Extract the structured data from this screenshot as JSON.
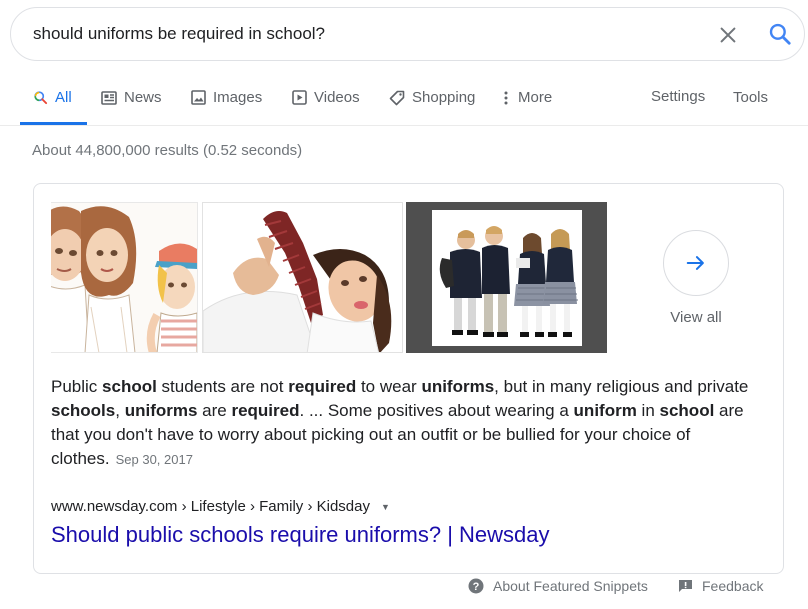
{
  "search": {
    "query": "should uniforms be required in school?"
  },
  "tabs": [
    {
      "label": "All",
      "icon": "search-icon",
      "active": true
    },
    {
      "label": "News",
      "icon": "news-icon"
    },
    {
      "label": "Images",
      "icon": "image-icon"
    },
    {
      "label": "Videos",
      "icon": "video-icon"
    },
    {
      "label": "Shopping",
      "icon": "tag-icon"
    },
    {
      "label": "More",
      "icon": "more-vert-icon"
    }
  ],
  "tools": {
    "settings_label": "Settings",
    "tools_label": "Tools"
  },
  "result_stats": "About 44,800,000 results (0.52 seconds)",
  "featured_snippet": {
    "view_all_label": "View all",
    "text_segments": [
      {
        "t": "Public ",
        "b": false
      },
      {
        "t": "school",
        "b": true
      },
      {
        "t": " students are not ",
        "b": false
      },
      {
        "t": "required",
        "b": true
      },
      {
        "t": " to wear ",
        "b": false
      },
      {
        "t": "uniforms",
        "b": true
      },
      {
        "t": ", but in many religious and private ",
        "b": false
      },
      {
        "t": "schools",
        "b": true
      },
      {
        "t": ", ",
        "b": false
      },
      {
        "t": "uniforms",
        "b": true
      },
      {
        "t": " are ",
        "b": false
      },
      {
        "t": "required",
        "b": true
      },
      {
        "t": ". ... Some positives about wearing a ",
        "b": false
      },
      {
        "t": "uniform",
        "b": true
      },
      {
        "t": " in ",
        "b": false
      },
      {
        "t": "school",
        "b": true
      },
      {
        "t": " are that you don't have to worry about picking out an outfit or be bullied for your choice of clothes.",
        "b": false
      }
    ],
    "date": "Sep 30, 2017",
    "cite": "www.newsday.com › Lifestyle › Family › Kidsday",
    "title": "Should public schools require uniforms? | Newsday"
  },
  "footer": {
    "about_label": "About Featured Snippets",
    "feedback_label": "Feedback"
  },
  "colors": {
    "accent": "#1a73e8",
    "link": "#1a0dab",
    "muted": "#70757a"
  }
}
